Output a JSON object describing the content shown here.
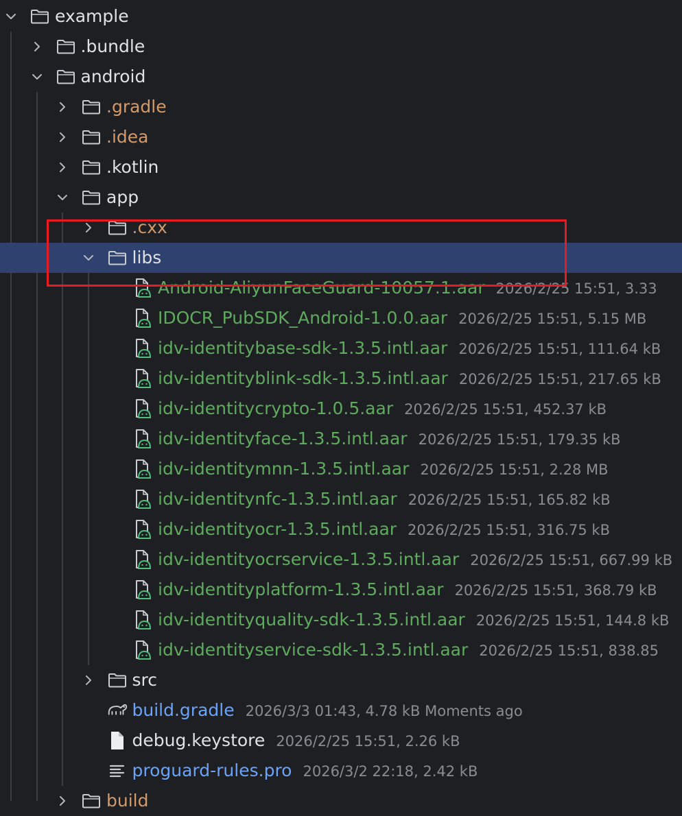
{
  "colors": {
    "background": "#1e1f22",
    "selection": "#2f426f",
    "highlight_box": "#e81b23",
    "text_default": "#dfe1e5",
    "text_excluded": "#d49a6a",
    "text_library": "#5faa5f",
    "text_modified": "#6aa3f7",
    "text_meta": "#8a8c91"
  },
  "tree": [
    {
      "label": "example",
      "depth": 0,
      "chevron": "down",
      "icon": "folder-icon",
      "color": "default"
    },
    {
      "label": ".bundle",
      "depth": 1,
      "chevron": "right",
      "icon": "folder-icon",
      "color": "default"
    },
    {
      "label": "android",
      "depth": 1,
      "chevron": "down",
      "icon": "folder-icon",
      "color": "default"
    },
    {
      "label": ".gradle",
      "depth": 2,
      "chevron": "right",
      "icon": "folder-icon",
      "color": "orange"
    },
    {
      "label": ".idea",
      "depth": 2,
      "chevron": "right",
      "icon": "folder-icon",
      "color": "orange"
    },
    {
      "label": ".kotlin",
      "depth": 2,
      "chevron": "right",
      "icon": "folder-icon",
      "color": "default"
    },
    {
      "label": "app",
      "depth": 2,
      "chevron": "down",
      "icon": "folder-icon",
      "color": "default"
    },
    {
      "label": ".cxx",
      "depth": 3,
      "chevron": "right",
      "icon": "folder-icon",
      "color": "orange"
    },
    {
      "label": "libs",
      "depth": 3,
      "chevron": "down",
      "icon": "folder-icon",
      "color": "default",
      "selected": true
    },
    {
      "label": "Android-AliyunFaceGuard-10057.1.aar",
      "meta": "2026/2/25 15:51, 3.33",
      "depth": 4,
      "icon": "android-archive-icon",
      "color": "green"
    },
    {
      "label": "IDOCR_PubSDK_Android-1.0.0.aar",
      "meta": "2026/2/25 15:51, 5.15 MB",
      "depth": 4,
      "icon": "android-archive-icon",
      "color": "green"
    },
    {
      "label": "idv-identitybase-sdk-1.3.5.intl.aar",
      "meta": "2026/2/25 15:51, 111.64 kB",
      "depth": 4,
      "icon": "android-archive-icon",
      "color": "green"
    },
    {
      "label": "idv-identityblink-sdk-1.3.5.intl.aar",
      "meta": "2026/2/25 15:51, 217.65 kB",
      "depth": 4,
      "icon": "android-archive-icon",
      "color": "green"
    },
    {
      "label": "idv-identitycrypto-1.0.5.aar",
      "meta": "2026/2/25 15:51, 452.37 kB",
      "depth": 4,
      "icon": "android-archive-icon",
      "color": "green"
    },
    {
      "label": "idv-identityface-1.3.5.intl.aar",
      "meta": "2026/2/25 15:51, 179.35 kB",
      "depth": 4,
      "icon": "android-archive-icon",
      "color": "green"
    },
    {
      "label": "idv-identitymnn-1.3.5.intl.aar",
      "meta": "2026/2/25 15:51, 2.28 MB",
      "depth": 4,
      "icon": "android-archive-icon",
      "color": "green"
    },
    {
      "label": "idv-identitynfc-1.3.5.intl.aar",
      "meta": "2026/2/25 15:51, 165.82 kB",
      "depth": 4,
      "icon": "android-archive-icon",
      "color": "green"
    },
    {
      "label": "idv-identityocr-1.3.5.intl.aar",
      "meta": "2026/2/25 15:51, 316.75 kB",
      "depth": 4,
      "icon": "android-archive-icon",
      "color": "green"
    },
    {
      "label": "idv-identityocrservice-1.3.5.intl.aar",
      "meta": "2026/2/25 15:51, 667.99 kB",
      "depth": 4,
      "icon": "android-archive-icon",
      "color": "green"
    },
    {
      "label": "idv-identityplatform-1.3.5.intl.aar",
      "meta": "2026/2/25 15:51, 368.79 kB",
      "depth": 4,
      "icon": "android-archive-icon",
      "color": "green"
    },
    {
      "label": "idv-identityquality-sdk-1.3.5.intl.aar",
      "meta": "2026/2/25 15:51, 144.8 kB",
      "depth": 4,
      "icon": "android-archive-icon",
      "color": "green"
    },
    {
      "label": "idv-identityservice-sdk-1.3.5.intl.aar",
      "meta": "2026/2/25 15:51, 838.85",
      "depth": 4,
      "icon": "android-archive-icon",
      "color": "green"
    },
    {
      "label": "src",
      "depth": 3,
      "chevron": "right",
      "icon": "folder-icon",
      "color": "default"
    },
    {
      "label": "build.gradle",
      "meta": "2026/3/3 01:43, 4.78 kB Moments ago",
      "depth": 3,
      "icon": "gradle-elephant-icon",
      "color": "blue"
    },
    {
      "label": "debug.keystore",
      "meta": "2026/2/25 15:51, 2.26 kB",
      "depth": 3,
      "icon": "file-icon",
      "color": "default"
    },
    {
      "label": "proguard-rules.pro",
      "meta": "2026/3/2 22:18, 2.42 kB",
      "depth": 3,
      "icon": "text-file-icon",
      "color": "blue"
    },
    {
      "label": "build",
      "depth": 2,
      "chevron": "right",
      "icon": "folder-icon",
      "color": "orange"
    }
  ]
}
